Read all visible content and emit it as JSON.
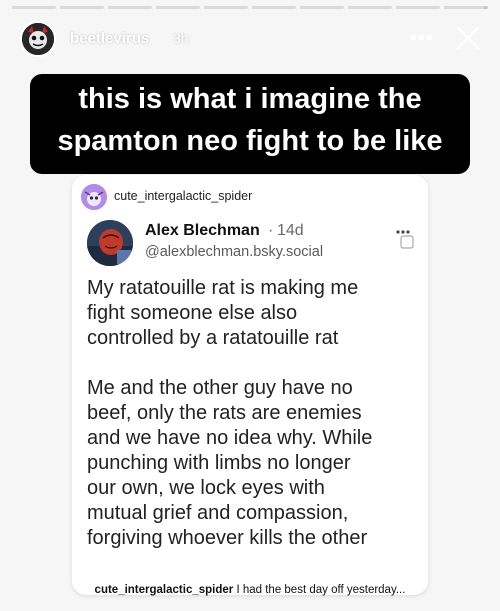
{
  "story": {
    "username": "beetlevirus",
    "time": "3h",
    "progress_segments": [
      1,
      1,
      1,
      1,
      1,
      1,
      1,
      1,
      1,
      0.9
    ],
    "caption_lines": [
      "this is what i imagine the",
      "spamton neo fight to be like"
    ]
  },
  "icons": {
    "more": "more-horizontal-icon",
    "close": "close-icon"
  },
  "post": {
    "sharer": "cute_intergalactic_spider",
    "author_name": "Alex Blechman",
    "separator": "·",
    "time": "14d",
    "handle": "@alexblechman.bsky.social",
    "paragraphs": [
      "My ratatouille rat is making me\nfight someone else also\ncontrolled by a ratatouille rat",
      "Me and the other guy have no\nbeef, only the rats are enemies\nand we have no idea why. While\npunching with limbs no longer\nour own, we lock eyes with\nmutual grief and compassion,\nforgiving whoever kills the other"
    ]
  },
  "footer": {
    "user": "cute_intergalactic_spider",
    "text": "I had the best day off yesterday..."
  },
  "colors": {
    "caption_bg": "#000000",
    "caption_text": "#ffffff",
    "page_bg": "#f6f6f6",
    "card_bg": "#ffffff"
  }
}
